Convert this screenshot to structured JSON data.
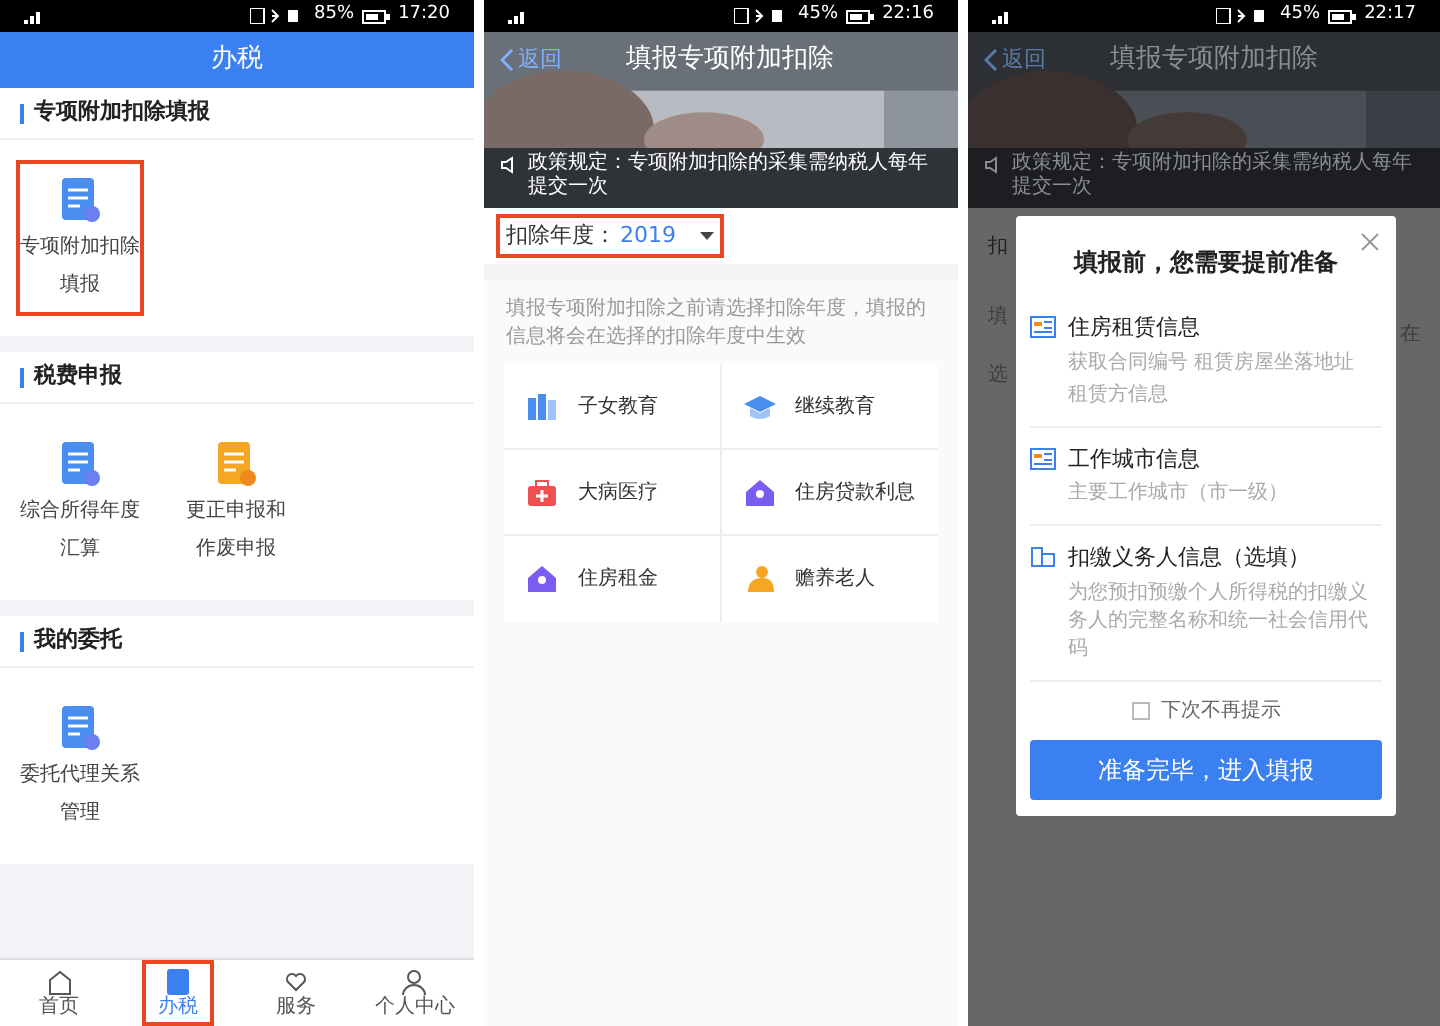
{
  "home_screen": {
    "status_bar": {
      "battery": "85%",
      "time": "17:20"
    },
    "title": "办税",
    "sections": [
      {
        "title": "专项附加扣除填报",
        "tiles": [
          {
            "label_lines": [
              "专项附加扣除",
              "填报"
            ],
            "highlighted": true
          }
        ]
      },
      {
        "title": "税费申报",
        "tiles": [
          {
            "label_lines": [
              "综合所得年度",
              "汇算"
            ],
            "highlighted": false
          },
          {
            "label_lines": [
              "更正申报和",
              "作废申报"
            ],
            "highlighted": false
          }
        ]
      },
      {
        "title": "我的委托",
        "tiles": [
          {
            "label_lines": [
              "委托代理关系",
              "管理"
            ],
            "highlighted": false
          }
        ]
      }
    ],
    "tab_bar": [
      {
        "label": "首页",
        "selected": false,
        "highlighted": false
      },
      {
        "label": "办税",
        "selected": true,
        "highlighted": true
      },
      {
        "label": "服务",
        "selected": false,
        "highlighted": false
      },
      {
        "label": "个人中心",
        "selected": false,
        "highlighted": false
      }
    ]
  },
  "deduction_screen": {
    "status_bar": {
      "battery": "45%",
      "time": "22:16"
    },
    "back_label": "返回",
    "title": "填报专项附加扣除",
    "notice": "政策规定：专项附加扣除的采集需纳税人每年提交一次",
    "year": {
      "label": "扣除年度：",
      "value": "2019",
      "highlighted": true
    },
    "description": "填报专项附加扣除之前请选择扣除年度，填报的信息将会在选择的扣除年度中生效",
    "categories": [
      {
        "label": "子女教育"
      },
      {
        "label": "继续教育"
      },
      {
        "label": "大病医疗"
      },
      {
        "label": "住房贷款利息"
      },
      {
        "label": "住房租金"
      },
      {
        "label": "赡养老人"
      }
    ]
  },
  "prepare_screen": {
    "status_bar": {
      "battery": "45%",
      "time": "22:17"
    },
    "back_label": "返回",
    "title": "填报专项附加扣除",
    "notice": "政策规定：专项附加扣除的采集需纳税人每年提交一次",
    "partial_left": [
      "扣",
      "填",
      "选"
    ],
    "partial_right": [
      "在"
    ],
    "dialog": {
      "title": "填报前，您需要提前准备",
      "items": [
        {
          "title": "住房租赁信息",
          "description_lines": [
            "获取合同编号 租赁房屋坐落地址",
            "租赁方信息"
          ]
        },
        {
          "title": "工作城市信息",
          "description_lines": [
            "主要工作城市（市一级）"
          ]
        },
        {
          "title": "扣缴义务人信息（选填）",
          "description_lines": [
            "为您预扣预缴个人所得税的扣缴义务人的完整名称和统一社会信用代码"
          ]
        }
      ],
      "checkbox": {
        "label": "下次不再提示",
        "checked": false
      },
      "button": "准备完毕，进入填报"
    }
  }
}
